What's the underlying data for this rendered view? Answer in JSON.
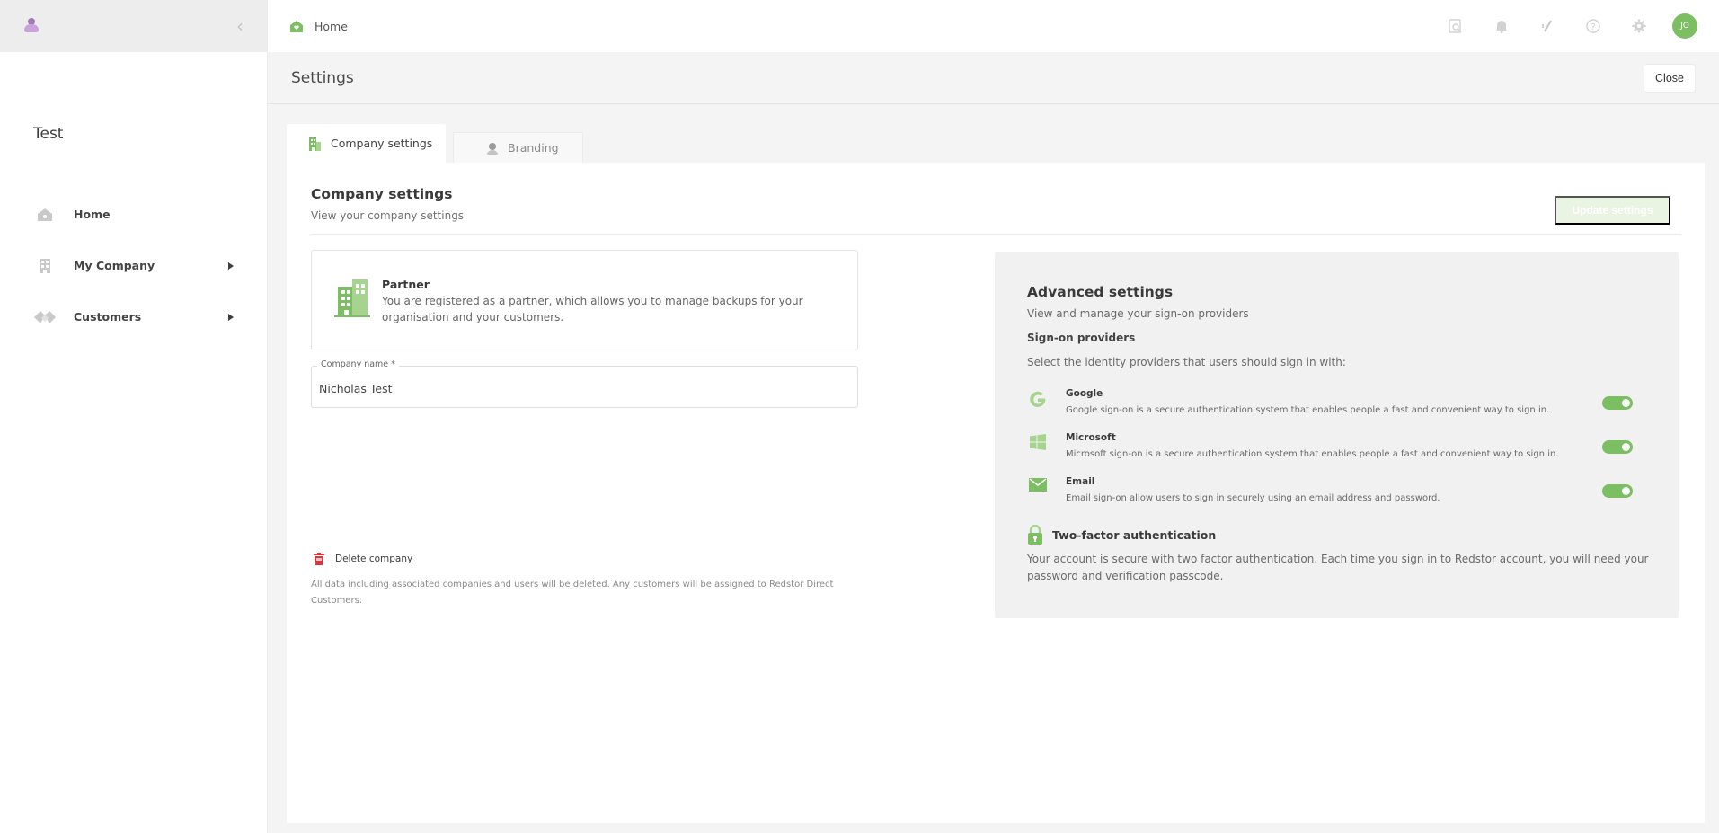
{
  "app": {
    "org_name": "Test"
  },
  "sidebar": {
    "items": [
      {
        "label": "Home",
        "icon": "house-icon",
        "has_submenu": false
      },
      {
        "label": "My Company",
        "icon": "building-icon",
        "has_submenu": true
      },
      {
        "label": "Customers",
        "icon": "customers-icon",
        "has_submenu": true
      }
    ]
  },
  "topbar": {
    "breadcrumb": "Home",
    "user_initials": "JO",
    "icons": [
      "search-icon",
      "bell-icon",
      "slash-icon",
      "help-icon",
      "gear-icon"
    ]
  },
  "page": {
    "title": "Settings",
    "close_label": "Close"
  },
  "tabs": [
    {
      "label": "Company settings",
      "active": true
    },
    {
      "label": "Branding",
      "active": false
    }
  ],
  "company_settings": {
    "title": "Company settings",
    "subtitle": "View your company settings",
    "update_button": "Update settings",
    "partner": {
      "title": "Partner",
      "description": "You are registered as a partner, which allows you to manage backups for your organisation and your customers."
    },
    "company_name": {
      "label": "Company name *",
      "value": "Nicholas Test"
    },
    "delete": {
      "link": "Delete company",
      "note": "All data including associated companies and users will be deleted. Any customers will be assigned to Redstor Direct Customers."
    }
  },
  "advanced": {
    "title": "Advanced settings",
    "subtitle": "View and manage your sign-on providers",
    "providers_heading": "Sign-on providers",
    "providers_instruction": "Select the identity providers that users should sign in with:",
    "providers": [
      {
        "name": "Google",
        "description": "Google sign-on is a secure authentication system that enables people a fast and convenient way to sign in.",
        "enabled": true
      },
      {
        "name": "Microsoft",
        "description": "Microsoft sign-on is a secure authentication system that enables people a fast and convenient way to sign in.",
        "enabled": true
      },
      {
        "name": "Email",
        "description": "Email sign-on allow users to sign in securely using an email address and password.",
        "enabled": true
      }
    ],
    "tfa_title": "Two-factor authentication",
    "tfa_description": "Your account is secure with two factor authentication. Each time you sign in to Redstor account, you will need your password and verification passcode."
  },
  "colors": {
    "accent": "#7cbf62",
    "accent_light": "#e9f4e3",
    "danger": "#d9363e"
  }
}
